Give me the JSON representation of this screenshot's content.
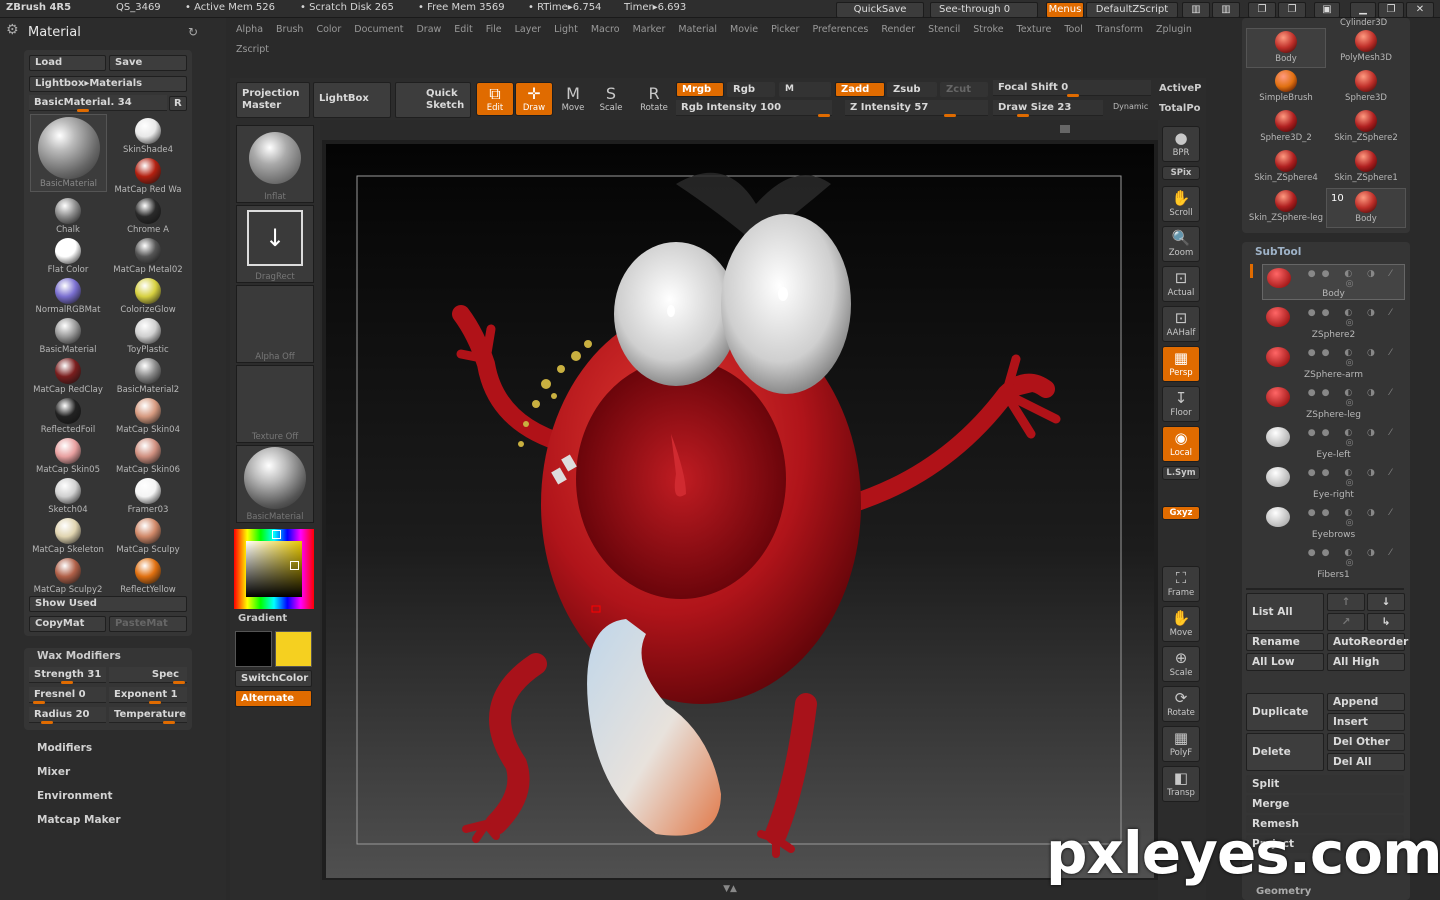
{
  "titlebar": {
    "app": "ZBrush 4R5",
    "doc": "QS_3469",
    "active_mem": "• Active Mem 526",
    "scratch": "• Scratch Disk 265",
    "free_mem": "• Free Mem 3569",
    "rtime": "• RTime▸6.754",
    "timer": "Timer▸6.693",
    "quicksave": "QuickSave",
    "seethrough": "See-through  0",
    "menus": "Menus",
    "script": "DefaultZScript"
  },
  "menu": [
    "Alpha",
    "Brush",
    "Color",
    "Document",
    "Draw",
    "Edit",
    "File",
    "Layer",
    "Light",
    "Macro",
    "Marker",
    "Material",
    "Movie",
    "Picker",
    "Preferences",
    "Render",
    "Stencil",
    "Stroke",
    "Texture",
    "Tool",
    "Transform",
    "Zplugin"
  ],
  "menu2": "Zscript",
  "material_panel": {
    "title": "Material",
    "load": "Load",
    "save": "Save",
    "lightbox": "Lightbox▸Materials",
    "current": "BasicMaterial. 34",
    "r": "R",
    "materials": [
      {
        "name": "BasicMaterial",
        "color": "#9a9a9a"
      },
      {
        "name": "SkinShade4",
        "color": "#e8e8e8"
      },
      {
        "name": "MatCap Red Wa",
        "color": "#b32010"
      },
      {
        "name": "Chalk",
        "color": "#8c8c8c"
      },
      {
        "name": "Chrome A",
        "color": "#2a2a2a"
      },
      {
        "name": "Flat Color",
        "color": "#ffffff"
      },
      {
        "name": "MatCap Metal02",
        "color": "#555555"
      },
      {
        "name": "NormalRGBMat",
        "color": "#7a6fd0"
      },
      {
        "name": "ColorizeGlow",
        "color": "#d6d040"
      },
      {
        "name": "BasicMaterial",
        "color": "#9a9a9a"
      },
      {
        "name": "ToyPlastic",
        "color": "#cfcfcf"
      },
      {
        "name": "MatCap RedClay",
        "color": "#7a1e1e"
      },
      {
        "name": "BasicMaterial2",
        "color": "#888888"
      },
      {
        "name": "ReflectedFoil",
        "color": "#222222"
      },
      {
        "name": "MatCap Skin04",
        "color": "#d69a80"
      },
      {
        "name": "MatCap Skin05",
        "color": "#e8a0a0"
      },
      {
        "name": "MatCap Skin06",
        "color": "#d09080"
      },
      {
        "name": "Sketch04",
        "color": "#d0d0d0"
      },
      {
        "name": "Framer03",
        "color": "#f4f4f4"
      },
      {
        "name": "MatCap Skeleton",
        "color": "#e0d4b0"
      },
      {
        "name": "MatCap Sculpy",
        "color": "#d08868"
      },
      {
        "name": "MatCap Sculpy2",
        "color": "#b06048"
      },
      {
        "name": "ReflectYellow",
        "color": "#e07010"
      }
    ],
    "show_used": "Show Used",
    "copymat": "CopyMat",
    "pastemat": "PasteMat"
  },
  "wax": {
    "title": "Wax Modifiers",
    "strength": "Strength 31",
    "spec": "Spec",
    "fresnel": "Fresnel 0",
    "exponent": "Exponent 1",
    "radius": "Radius 20",
    "temperature": "Temperature"
  },
  "left_menu": [
    "Modifiers",
    "Mixer",
    "Environment",
    "Matcap Maker"
  ],
  "thumbs": {
    "inflat": "Inflat",
    "dragrect": "DragRect",
    "alpha": "Alpha Off",
    "texture": "Texture Off",
    "material": "BasicMaterial",
    "gradient": "Gradient",
    "switchcolor": "SwitchColor",
    "alternate": "Alternate",
    "fg_color": "#000000",
    "bg_color": "#f5d020"
  },
  "toolbar": {
    "projection": "Projection Master",
    "lightbox": "LightBox",
    "quicksketch": "Quick Sketch",
    "edit": "Edit",
    "draw": "Draw",
    "move": "Move",
    "scale": "Scale",
    "rotate": "Rotate",
    "mrgb": "Mrgb",
    "rgb": "Rgb",
    "m": "M",
    "rgb_intensity": "Rgb Intensity 100",
    "zadd": "Zadd",
    "zsub": "Zsub",
    "zcut": "Zcut",
    "z_intensity": "Z Intensity 57",
    "focal": "Focal Shift 0",
    "draw_size": "Draw Size 23",
    "dynamic": "Dynamic",
    "activep": "ActiveP",
    "totalpo": "TotalPo"
  },
  "right_shelf": [
    "BPR",
    "SPix",
    "Scroll",
    "Zoom",
    "Actual",
    "AAHalf",
    "Persp",
    "Floor",
    "Local",
    "L.Sym",
    "Gxyz",
    "Frame",
    "Move",
    "Scale",
    "Rotate",
    "PolyF",
    "Transp"
  ],
  "tool_palette": [
    {
      "name": "Body"
    },
    {
      "name": "PolyMesh3D"
    },
    {
      "name": "SimpleBrush"
    },
    {
      "name": "Sphere3D"
    },
    {
      "name": "Sphere3D_2"
    },
    {
      "name": "Skin_ZSphere2"
    },
    {
      "name": "Skin_ZSphere4"
    },
    {
      "name": "Skin_ZSphere1"
    },
    {
      "name": "Skin_ZSphere-leg"
    },
    {
      "name": "Body"
    }
  ],
  "tool_top": "Cylinder3D",
  "tool_count": "10",
  "subtool": {
    "title": "SubTool",
    "items": [
      "Body",
      "ZSphere2",
      "ZSphere-arm",
      "ZSphere-leg",
      "Eye-left",
      "Eye-right",
      "Eyebrows",
      "Fibers1"
    ],
    "list_all": "List All",
    "rename": "Rename",
    "autoreorder": "AutoReorder",
    "all_low": "All Low",
    "all_high": "All High",
    "append": "Append",
    "duplicate": "Duplicate",
    "insert": "Insert",
    "delete": "Delete",
    "del_other": "Del Other",
    "del_all": "Del All",
    "split": "Split",
    "merge": "Merge",
    "remesh": "Remesh",
    "project": "Project",
    "geometry": "Geometry"
  },
  "watermark": "pxleyes.com"
}
